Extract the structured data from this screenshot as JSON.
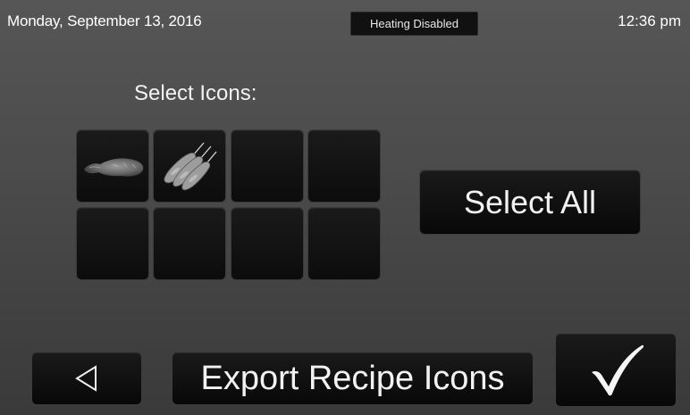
{
  "status": {
    "date": "Monday, September 13, 2016",
    "badge": "Heating Disabled",
    "time": "12:36 pm"
  },
  "main": {
    "title": "Select Icons:",
    "icon_tiles": [
      {
        "icon": "drumstick-icon"
      },
      {
        "icon": "corn-dogs-icon"
      },
      {
        "icon": ""
      },
      {
        "icon": ""
      },
      {
        "icon": ""
      },
      {
        "icon": ""
      },
      {
        "icon": ""
      },
      {
        "icon": ""
      }
    ],
    "select_all_label": "Select All"
  },
  "footer": {
    "back_icon": "back-triangle-icon",
    "export_label": "Export Recipe Icons",
    "confirm_icon": "checkmark-icon"
  }
}
